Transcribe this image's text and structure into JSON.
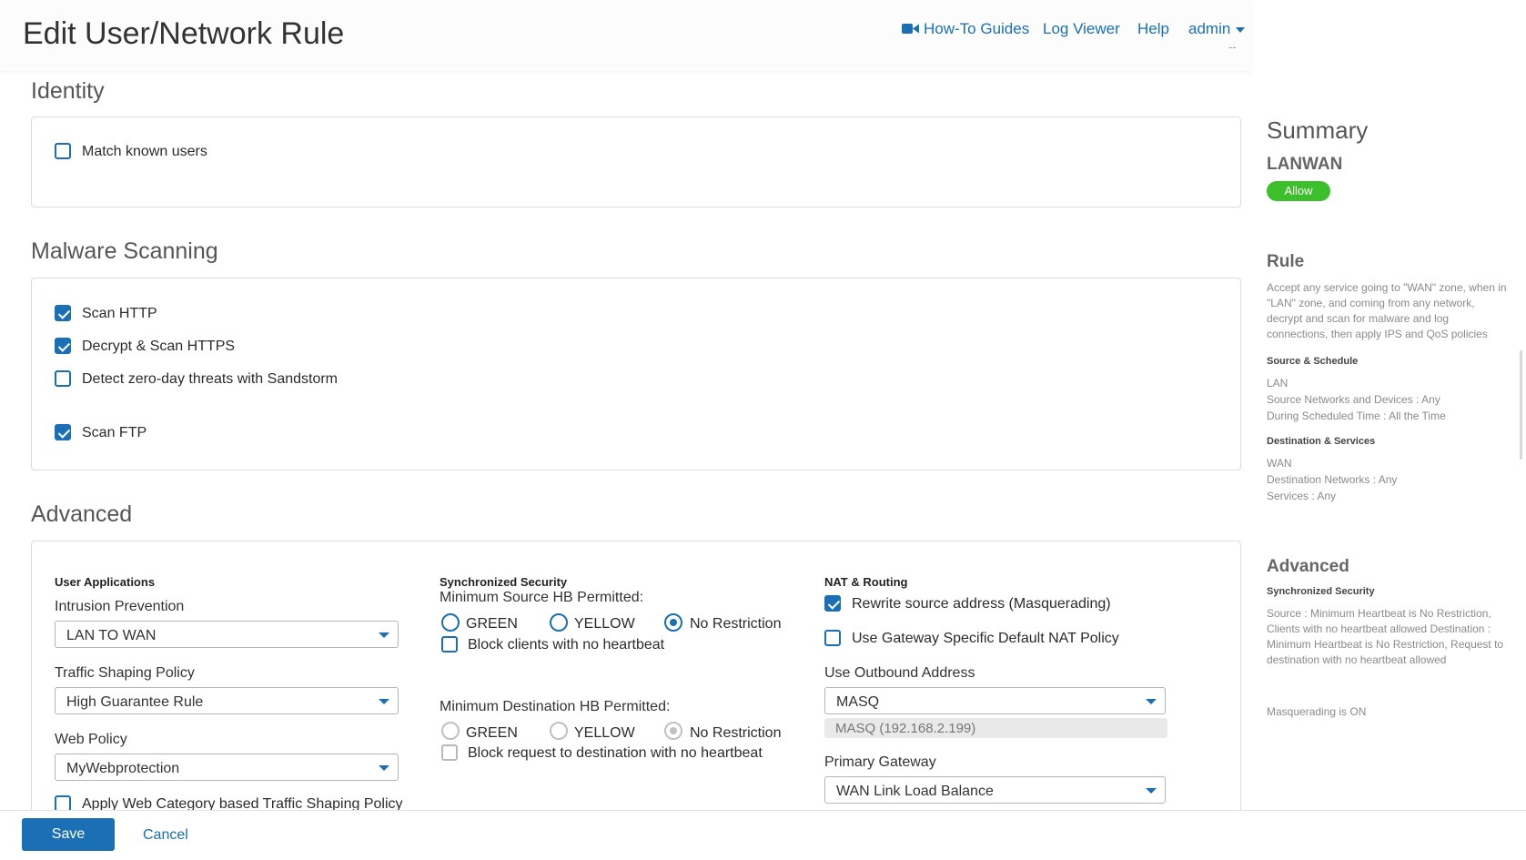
{
  "header": {
    "title": "Edit User/Network Rule",
    "links": {
      "howto": "How-To Guides",
      "logviewer": "Log Viewer",
      "help": "Help",
      "admin": "admin"
    },
    "dashes": "--"
  },
  "identity": {
    "title": "Identity",
    "match_known_users": {
      "label": "Match known users",
      "checked": false
    }
  },
  "malware": {
    "title": "Malware Scanning",
    "scan_http": {
      "label": "Scan HTTP",
      "checked": true
    },
    "decrypt_https": {
      "label": "Decrypt & Scan HTTPS",
      "checked": true
    },
    "sandstorm": {
      "label": "Detect zero-day threats with Sandstorm",
      "checked": false
    },
    "scan_ftp": {
      "label": "Scan FTP",
      "checked": true
    }
  },
  "advanced": {
    "title": "Advanced",
    "user_apps": {
      "heading": "User Applications",
      "ips_label": "Intrusion Prevention",
      "ips_value": "LAN TO WAN",
      "shaping_label": "Traffic Shaping Policy",
      "shaping_value": "High Guarantee Rule",
      "web_label": "Web Policy",
      "web_value": "MyWebprotection",
      "web_category_label": "Apply Web Category based Traffic Shaping Policy"
    },
    "sync_security": {
      "heading": "Synchronized Security",
      "min_source_label": "Minimum Source HB Permitted:",
      "options": [
        "GREEN",
        "YELLOW",
        "No Restriction"
      ],
      "source_selected": "No Restriction",
      "block_clients_label": "Block clients with no heartbeat",
      "min_dest_label": "Minimum Destination HB Permitted:",
      "dest_selected": "No Restriction",
      "block_dest_label": "Block request to destination with no heartbeat"
    },
    "nat": {
      "heading": "NAT & Routing",
      "masq_label": "Rewrite source address (Masquerading)",
      "masq_checked": true,
      "gateway_nat_label": "Use Gateway Specific Default NAT Policy",
      "gateway_nat_checked": false,
      "outbound_label": "Use Outbound Address",
      "outbound_value": "MASQ",
      "outbound_readonly": "MASQ (192.168.2.199)",
      "primary_gateway_label": "Primary Gateway",
      "primary_gateway_value": "WAN Link Load Balance"
    }
  },
  "summary": {
    "title": "Summary",
    "rule_name": "LANWAN",
    "action_badge": "Allow",
    "rule_heading": "Rule",
    "rule_desc": "Accept any service going to \"WAN\" zone, when in \"LAN\" zone, and coming from any network, decrypt and scan for malware and log connections, then apply IPS and QoS policies",
    "source_heading": "Source & Schedule",
    "source_lines": [
      "LAN",
      "Source Networks and Devices : Any",
      "During Scheduled Time : All the Time"
    ],
    "dest_heading": "Destination & Services",
    "dest_lines": [
      "WAN",
      "Destination Networks : Any",
      "Services : Any"
    ],
    "advanced_heading": "Advanced",
    "sync_heading": "Synchronized Security",
    "sync_text": "Source : Minimum Heartbeat is No Restriction, Clients with no heartbeat allowed Destination : Minimum Heartbeat is No Restriction, Request to destination with no heartbeat allowed",
    "masq_text": "Masquerading is ON"
  },
  "footer": {
    "save": "Save",
    "cancel": "Cancel"
  },
  "colors": {
    "accent": "#1a6fb5",
    "allow_badge": "#3bbf2b"
  },
  "icons": [
    "video-camera-icon",
    "caret-down-icon",
    "checkbox-icon",
    "radio-icon",
    "dropdown-arrow-icon"
  ]
}
